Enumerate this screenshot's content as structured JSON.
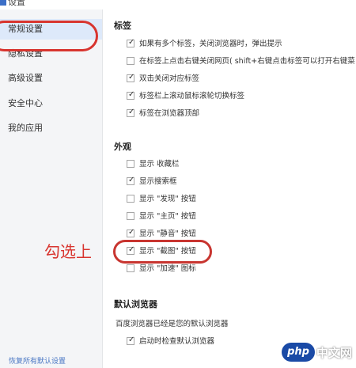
{
  "window": {
    "title": "设置"
  },
  "sidebar": {
    "items": [
      {
        "label": "常规设置",
        "active": true
      },
      {
        "label": "隐私设置"
      },
      {
        "label": "高级设置"
      },
      {
        "label": "安全中心"
      },
      {
        "label": "我的应用"
      }
    ],
    "restore_label": "恢复所有默认设置"
  },
  "sections": {
    "tabs": {
      "title": "标签",
      "options": [
        {
          "label": "如果有多个标签，关闭浏览器时，弹出提示",
          "checked": true
        },
        {
          "label": "在标签上点击右键关闭网页( shift+右键点击标签可以打开右键菜",
          "checked": false
        },
        {
          "label": "双击关闭对应标签",
          "checked": true
        },
        {
          "label": "标签栏上滚动鼠标滚轮切换标签",
          "checked": true
        },
        {
          "label": "标签在浏览器顶部",
          "checked": true
        }
      ]
    },
    "appearance": {
      "title": "外观",
      "options": [
        {
          "label": "显示 收藏栏",
          "checked": false
        },
        {
          "label": "显示搜索框",
          "checked": true
        },
        {
          "label": "显示 \"发现\" 按钮",
          "checked": false
        },
        {
          "label": "显示 \"主页\" 按钮",
          "checked": false
        },
        {
          "label": "显示 \"静音\" 按钮",
          "checked": true
        },
        {
          "label": "显示 \"截图\" 按钮",
          "checked": true
        },
        {
          "label": "显示 \"加速\" 图标",
          "checked": false
        }
      ]
    },
    "default_browser": {
      "title": "默认浏览器",
      "status_text": "百度浏览器已经是您的默认浏览器",
      "options": [
        {
          "label": "启动时检查默认浏览器",
          "checked": true
        }
      ]
    }
  },
  "annotation": {
    "text": "勾选上",
    "color": "#d8352f"
  },
  "watermark": {
    "logo": "php",
    "site": "中文网"
  },
  "colors": {
    "accent": "#d8352f",
    "active_bg": "#dde9fa",
    "link": "#4a77c4"
  }
}
